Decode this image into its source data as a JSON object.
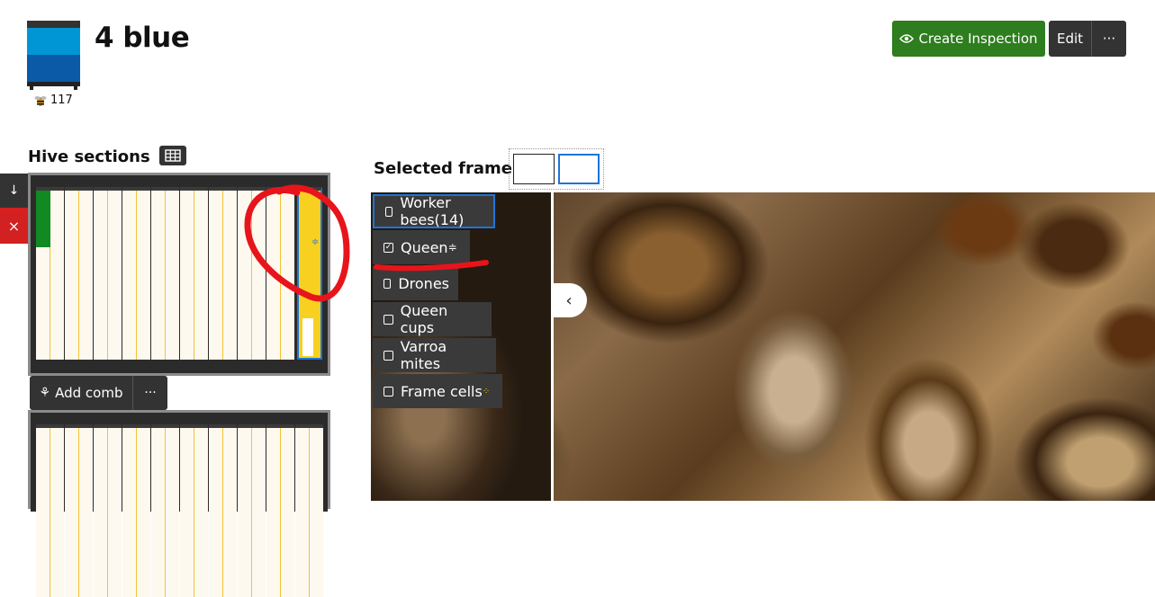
{
  "hive": {
    "title": "4 blue",
    "bee_count": "117",
    "colors": {
      "upper_box": "#0096d6",
      "lower_box": "#0a5aa8"
    }
  },
  "header_actions": {
    "create_inspection": "Create Inspection",
    "edit": "Edit",
    "more": "···"
  },
  "hive_sections": {
    "title": "Hive sections",
    "add_comb": "Add comb",
    "more": "···",
    "down_icon": "↓",
    "delete_icon": "×"
  },
  "selected_frame": {
    "title": "Selected frame",
    "tags": [
      {
        "label": "Worker bees(14)",
        "checked": false
      },
      {
        "label": "Queen",
        "checked": true
      },
      {
        "label": "Drones",
        "checked": false
      },
      {
        "label": "Queen cups",
        "checked": false
      },
      {
        "label": "Varroa mites",
        "checked": false
      },
      {
        "label": "Frame cells",
        "checked": false
      }
    ]
  },
  "accent_colors": {
    "primary": "#2e7d1f",
    "selected": "#1e74d8",
    "danger": "#d32020",
    "annotation": "#e8141b"
  }
}
